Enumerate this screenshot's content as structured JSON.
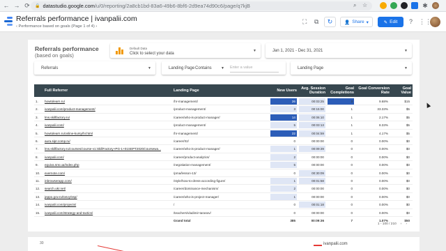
{
  "browser": {
    "url_host": "datastudio.google.com",
    "url_path": "/u/0/reporting/2a8cb1bd-83a6-49b6-8bf6-2d9ea74d90c6/page/q7kjB"
  },
  "header": {
    "title": "Referrals performance | ivanpalii.com",
    "subtitle": "Performance based on goals (Page 1 of 4)",
    "share_label": "Share",
    "edit_label": "Edit"
  },
  "report": {
    "title": "Referrals performance",
    "subtitle": "(based on goals)"
  },
  "controls": {
    "data_source_small": "Default Data",
    "data_source_label": "Click to select your data",
    "date_range": "Jan 1, 2021 - Dec 31, 2021",
    "referrals_label": "Referrals",
    "landing_page_label": "Landing Page",
    "landing_page_operator": "Contains",
    "landing_page_placeholder": "Enter a value",
    "landing_page_dropdown": "Landing Page"
  },
  "table": {
    "columns": [
      "Full Referrer",
      "Landing Page",
      "New Users",
      "Avg. Session Duration",
      "Goal Completions",
      "Goal Conversion Rate",
      "Goal Value"
    ],
    "rows": [
      {
        "n": "1.",
        "ref": "howtolearn.ru/",
        "lp": "/hr-management/",
        "users": "26",
        "dur": "00:03:25",
        "goals": "3",
        "rate": "9.68%",
        "val": "$15",
        "ub": 0.95,
        "db": 0.3,
        "gb": 0.95
      },
      {
        "n": "2.",
        "ref": "ivanpalii.com/product-management/",
        "lp": "/product-management/",
        "users": "3",
        "dur": "00:15:00",
        "goals": "1",
        "rate": "33.33%",
        "val": "$5",
        "ub": 0.1,
        "db": 0.0,
        "gb": 0.0
      },
      {
        "n": "3.",
        "ref": "lms.skillfactory.ru/",
        "lp": "/career/who-is-product-manager/",
        "users": "14",
        "dur": "00:06:10",
        "goals": "1",
        "rate": "2.17%",
        "val": "$5",
        "ub": 0.6,
        "db": 0.0,
        "gb": 0.0
      },
      {
        "n": "4.",
        "ref": "ivanpalii.com/",
        "lp": "/product-management/",
        "users": "5",
        "dur": "00:03:13",
        "goals": "1",
        "rate": "8.33%",
        "val": "$5",
        "ub": 0.2,
        "db": 0.0,
        "gb": 0.0
      },
      {
        "n": "5.",
        "ref": "howtolearn.ru/online-kursy/hr.html",
        "lp": "/hr-management/",
        "users": "22",
        "dur": "00:04:59",
        "goals": "1",
        "rate": "4.17%",
        "val": "$5",
        "ub": 0.85,
        "db": 0.0,
        "gb": 0.0
      },
      {
        "n": "6.",
        "ref": "aura.sipr.comp.ru/",
        "lp": "/career/rtz/",
        "users": "0",
        "dur": "00:00:00",
        "goals": "0",
        "rate": "0.00%",
        "val": "$0",
        "ub": 0,
        "db": 0,
        "gb": 0
      },
      {
        "n": "7.",
        "ref": "lms.skillfactory.ru/courses/course-v1:SkillFactory+PG-1+01SEPT2020/coursewa...",
        "lp": "/career/who-is-product-manager/",
        "users": "1",
        "dur": "00:09:39",
        "goals": "0",
        "rate": "0.00%",
        "val": "$0",
        "ub": 0.05,
        "db": 0,
        "gb": 0
      },
      {
        "n": "8.",
        "ref": "ivanpalii.com/",
        "lp": "/career/product-analytics/",
        "users": "2",
        "dur": "00:00:00",
        "goals": "0",
        "rate": "0.00%",
        "val": "$0",
        "ub": 0.08,
        "db": 0,
        "gb": 0
      },
      {
        "n": "9.",
        "ref": "equiva.sns.ua/index.php",
        "lp": "/negotiation-management/",
        "users": "5",
        "dur": "00:00:00",
        "goals": "0",
        "rate": "0.00%",
        "val": "$0",
        "ub": 0.2,
        "db": 0,
        "gb": 0
      },
      {
        "n": "10.",
        "ref": "evernote.com/",
        "lp": "/pma/lesson-13/",
        "users": "0",
        "dur": "00:30:09",
        "goals": "0",
        "rate": "0.00%",
        "val": "$0",
        "ub": 0,
        "db": 0.0,
        "gb": 0
      },
      {
        "n": "11.",
        "ref": "inbrowserapp.com/",
        "lp": "/style/how-to-dress-according-figure/",
        "users": "1",
        "dur": "00:01:58",
        "goals": "0",
        "rate": "0.00%",
        "val": "$0",
        "ub": 0.05,
        "db": 0,
        "gb": 0
      },
      {
        "n": "12.",
        "ref": "search.ukr.net/",
        "lp": "/career/dominance-mechanism/",
        "users": "2",
        "dur": "00:00:00",
        "goals": "0",
        "rate": "0.00%",
        "val": "$0",
        "ub": 0.08,
        "db": 0,
        "gb": 0
      },
      {
        "n": "13.",
        "ref": "jeppo.gov.ru/tosvy/ssp/",
        "lp": "/career/who-is-project-manager/",
        "users": "1",
        "dur": "00:00:00",
        "goals": "0",
        "rate": "0.00%",
        "val": "$0",
        "ub": 0.05,
        "db": 0,
        "gb": 0
      },
      {
        "n": "14.",
        "ref": "ivanpalii.com/projects/",
        "lp": "/",
        "users": "0",
        "dur": "00:01:18",
        "goals": "0",
        "rate": "0.00%",
        "val": "$0",
        "ub": 0,
        "db": 0,
        "gb": 0
      },
      {
        "n": "15.",
        "ref": "ivanpalii.com/strategy-and-tactics/",
        "lp": "/teachers/vladimir-tarasov/",
        "users": "0",
        "dur": "00:00:00",
        "goals": "0",
        "rate": "0.00%",
        "val": "$0",
        "ub": 0,
        "db": 0,
        "gb": 0
      }
    ],
    "total": {
      "label": "Grand total",
      "users": "385",
      "dur": "00:09:36",
      "goals": "7",
      "rate": "1.07%",
      "val": "$50"
    },
    "pager": "1 - 100 / 210"
  },
  "chart_panel": {
    "y_tick": "30",
    "legend": "ivanpalii.com"
  },
  "colors": {
    "header_bg": "#37474f",
    "bar_strong": "#2c5db8",
    "bar_light": "#dfe6f5",
    "accent": "#1a73e8"
  }
}
